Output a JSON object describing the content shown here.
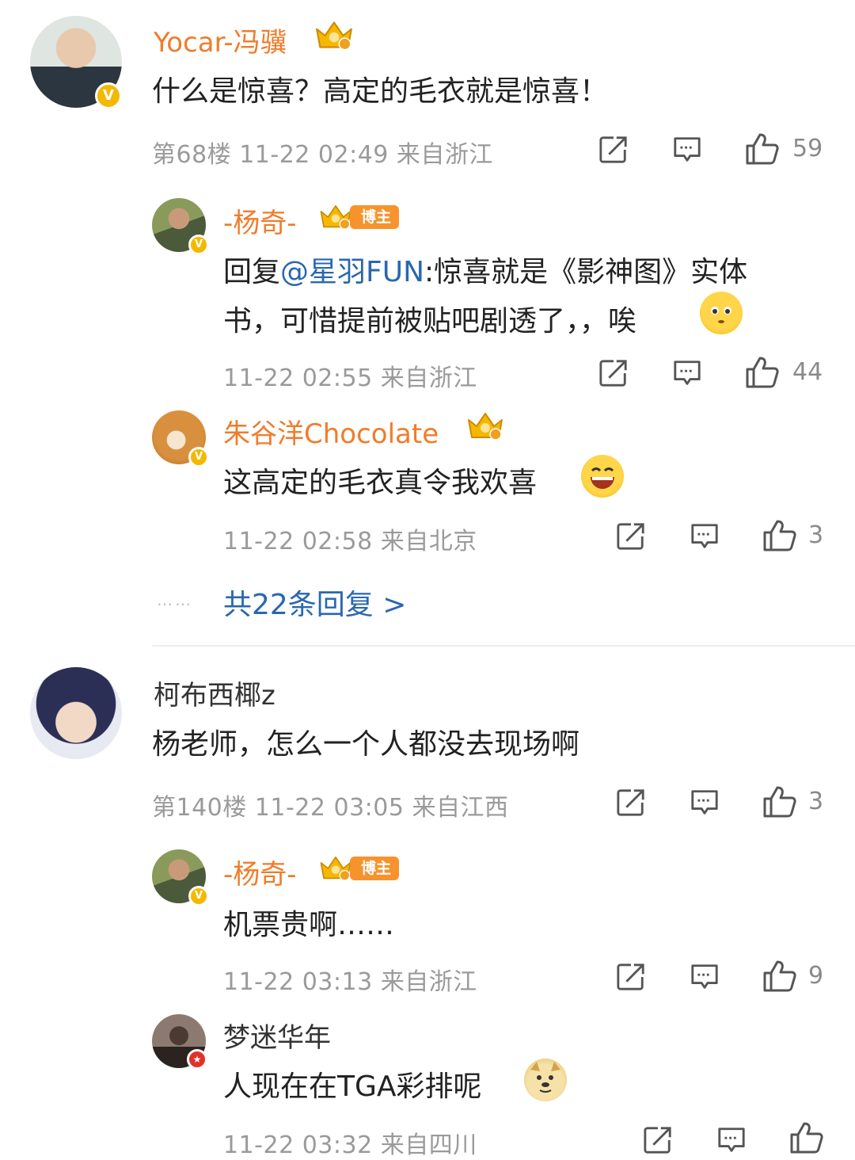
{
  "comments": [
    {
      "name": "Yocar-冯骥",
      "text": "什么是惊喜？高定的毛衣就是惊喜！",
      "meta": "第68楼 11-22 02:49 来自浙江",
      "likes": "59",
      "replies": [
        {
          "name": "-杨奇-",
          "badge": "博主",
          "text_prefix": "回复",
          "mention": "@星羽FUN",
          "text_line1": ":惊喜就是《影神图》实体",
          "text_line2": "书，可惜提前被贴吧剧透了，，唉",
          "meta": "11-22 02:55 来自浙江",
          "likes": "44"
        },
        {
          "name": "朱谷洋Chocolate",
          "text": "这高定的毛衣真令我欢喜",
          "meta": "11-22 02:58 来自北京",
          "likes": "3"
        }
      ],
      "more_dots": "……",
      "more_label": "共22条回复 >"
    },
    {
      "name": "柯布西椰z",
      "text": "杨老师，怎么一个人都没去现场啊",
      "meta": "第140楼 11-22 03:05 来自江西",
      "likes": "3",
      "replies": [
        {
          "name": "-杨奇-",
          "badge": "博主",
          "text": "机票贵啊……",
          "meta": "11-22 03:13 来自浙江",
          "likes": "9"
        },
        {
          "name": "梦迷华年",
          "text": "人现在在TGA彩排呢",
          "meta": "11-22 03:32 来自四川",
          "likes": ""
        }
      ]
    }
  ],
  "icons": {
    "share": "share-icon",
    "comment": "comment-icon",
    "like": "thumbs-up-icon",
    "crown": "crown-icon",
    "verified": "verified-v-icon"
  },
  "colors": {
    "vip_name": "#f07c2a",
    "mention": "#2a67b0",
    "meta": "#9a9a9a",
    "verified": "#f5b800",
    "bozhu_badge": "#f7932d"
  }
}
